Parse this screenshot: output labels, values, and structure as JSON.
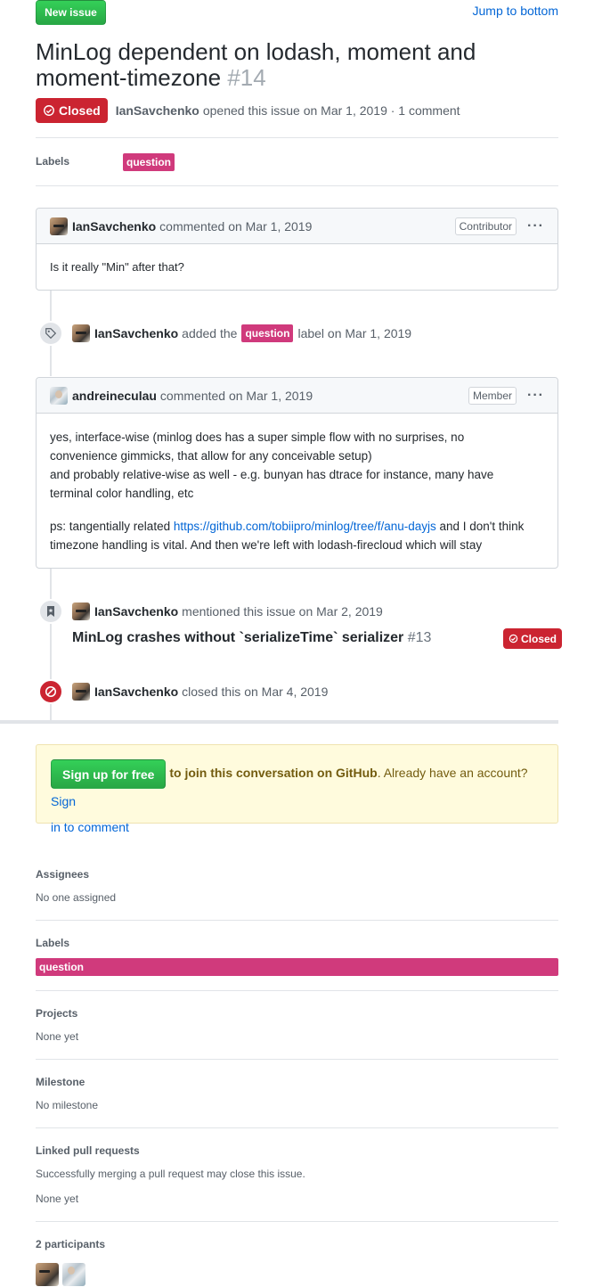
{
  "header": {
    "new_issue_label": "New issue",
    "jump_label": "Jump to bottom"
  },
  "issue": {
    "title": "MinLog dependent on lodash, moment and moment-timezone",
    "number": "#14",
    "state": "Closed",
    "author": "IanSavchenko",
    "opened_text": "opened this issue on Mar 1, 2019 · 1 comment"
  },
  "labels_row": {
    "heading": "Labels",
    "label": "question"
  },
  "comment1": {
    "author": "IanSavchenko",
    "meta": "commented on Mar 1, 2019",
    "role": "Contributor",
    "body": "Is it really \"Min\" after that?"
  },
  "event_label": {
    "author": "IanSavchenko",
    "pre": "added the",
    "label": "question",
    "post": "label on Mar 1, 2019"
  },
  "comment2": {
    "author": "andreineculau",
    "meta": "commented on Mar 1, 2019",
    "role": "Member",
    "para1_line1": "yes, interface-wise (minlog does has a super simple flow with no surprises, no",
    "para1_line2": "convenience gimmicks, that allow for any conceivable setup)",
    "para1_line3": "and probably relative-wise as well - e.g. bunyan has dtrace for instance, many have",
    "para1_line4": "terminal color handling, etc",
    "para2_pre": "ps: tangentially related ",
    "para2_link": "https://github.com/tobiipro/minlog/tree/f/anu-dayjs",
    "para2_post": " and I don't think",
    "para2_line2": "timezone handling is vital. And then we're left with lodash-firecloud which will stay"
  },
  "event_mention": {
    "author": "IanSavchenko",
    "text": "mentioned this issue on Mar 2, 2019",
    "ref_title": "MinLog crashes without `serializeTime` serializer",
    "ref_number": "#13",
    "ref_state": "Closed"
  },
  "event_closed": {
    "author": "IanSavchenko",
    "text": "closed this on Mar 4, 2019"
  },
  "signup": {
    "button": "Sign up for free",
    "bold_text": "to join this conversation on GitHub",
    "rest_text": ". Already have an account? ",
    "link_part1": "Sign",
    "link_part2": "in to comment"
  },
  "sidebar": {
    "assignees_heading": "Assignees",
    "assignees_value": "No one assigned",
    "labels_heading": "Labels",
    "labels_value": "question",
    "projects_heading": "Projects",
    "projects_value": "None yet",
    "milestone_heading": "Milestone",
    "milestone_value": "No milestone",
    "linked_heading": "Linked pull requests",
    "linked_desc": "Successfully merging a pull request may close this issue.",
    "linked_value": "None yet",
    "participants_heading": "2 participants"
  },
  "colors": {
    "label_question": "#d03a7c",
    "closed_red": "#cb2431",
    "link_blue": "#0366d6",
    "green": "#28a745",
    "flash_yellow": "#fffbdd"
  }
}
